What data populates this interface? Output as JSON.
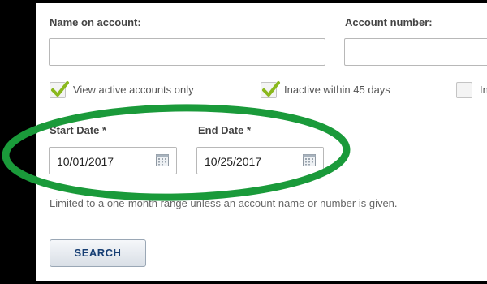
{
  "filters": {
    "name_label": "Name on account:",
    "name_value": "",
    "account_label": "Account number:",
    "account_value": "",
    "checkboxes": [
      {
        "label": "View active accounts only",
        "checked": true
      },
      {
        "label": "Inactive within 45 days",
        "checked": true
      },
      {
        "label": "In",
        "checked": false
      }
    ],
    "start_date_label": "Start Date *",
    "start_date_value": "10/01/2017",
    "end_date_label": "End Date *",
    "end_date_value": "10/25/2017",
    "date_note": "Limited to a one-month range unless an account name or number is given.",
    "search_label": "SEARCH"
  },
  "colors": {
    "highlight_ellipse": "#1a9a3a",
    "checkmark": "#8ab81d",
    "button_text": "#163e73",
    "frame": "#000000"
  },
  "icons": [
    "checkmark-icon",
    "calendar-icon"
  ]
}
